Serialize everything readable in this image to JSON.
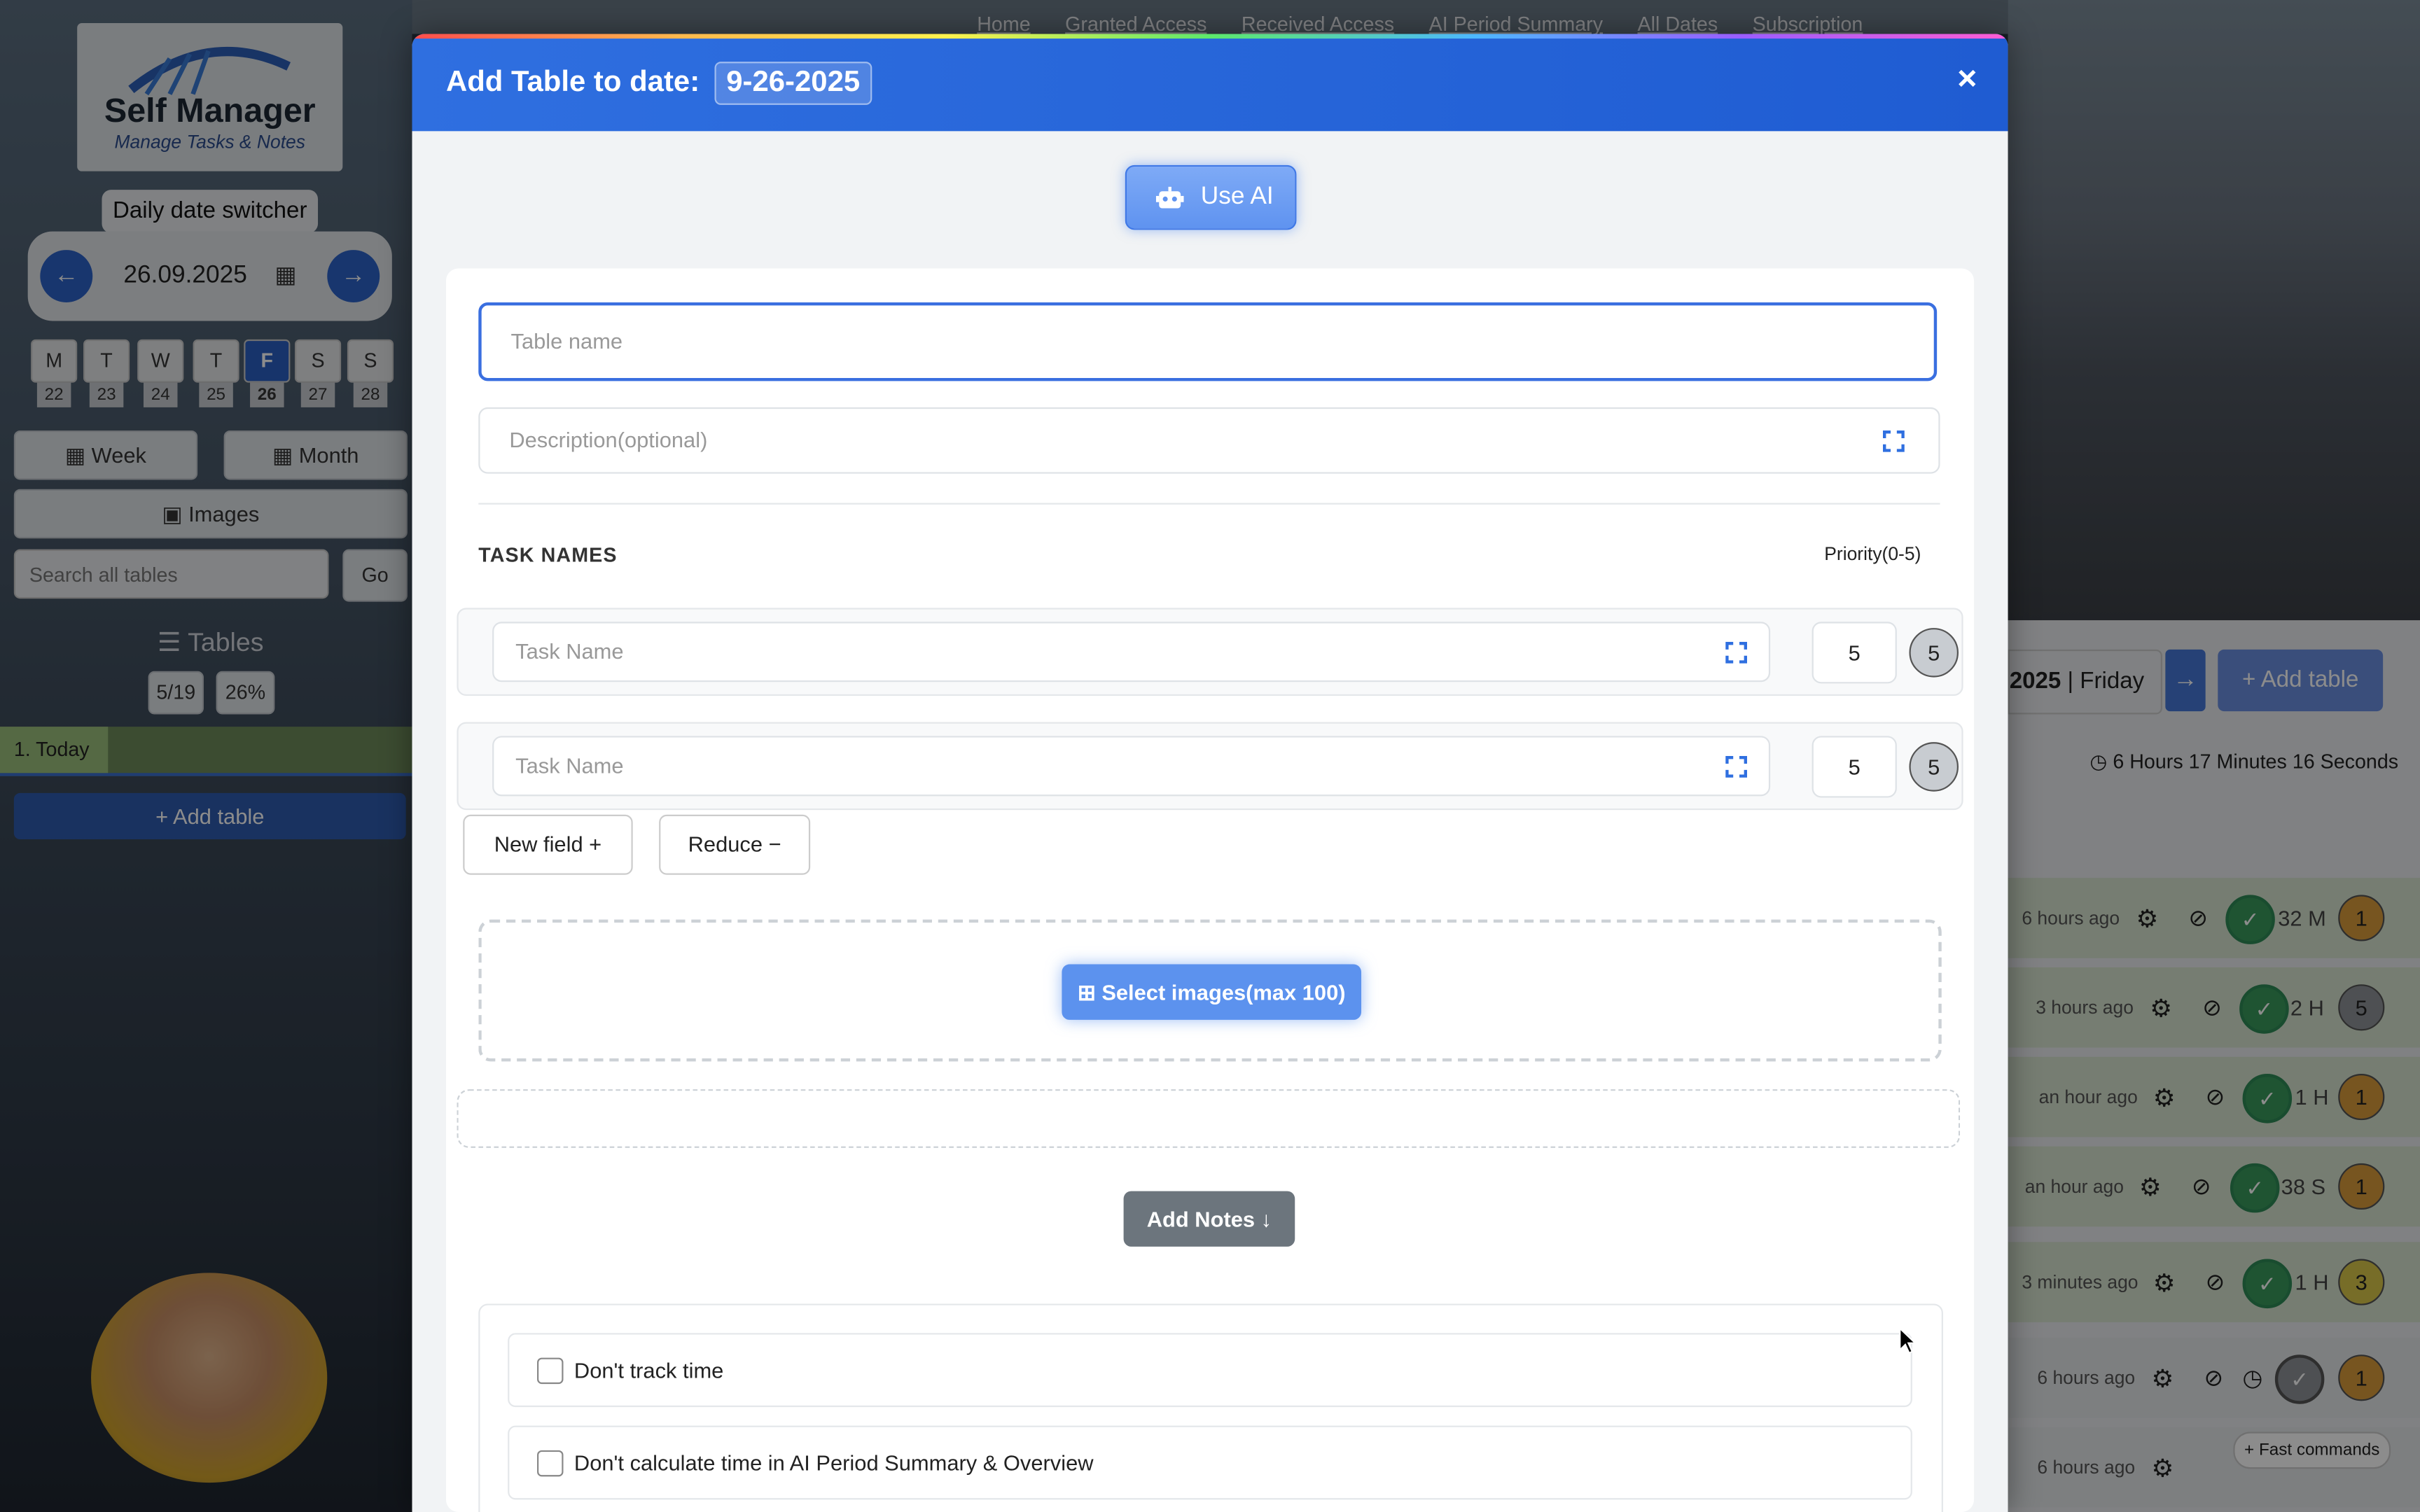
{
  "nav": {
    "items": [
      "Home",
      "Granted Access",
      "Received Access",
      "AI Period Summary",
      "All Dates",
      "Subscription"
    ]
  },
  "sidebar": {
    "logo_title": "Self Manager",
    "logo_subtitle": "Manage Tasks & Notes",
    "date_switcher_label": "Daily date switcher",
    "current_date": "26.09.2025",
    "days": [
      {
        "letter": "M",
        "num": "22"
      },
      {
        "letter": "T",
        "num": "23"
      },
      {
        "letter": "W",
        "num": "24"
      },
      {
        "letter": "T",
        "num": "25"
      },
      {
        "letter": "F",
        "num": "26"
      },
      {
        "letter": "S",
        "num": "27"
      },
      {
        "letter": "S",
        "num": "28"
      }
    ],
    "week_label": "Week",
    "month_label": "Month",
    "images_label": "Images",
    "search_placeholder": "Search all tables",
    "go_label": "Go",
    "tables_label": "Tables",
    "tables_count": "5/19",
    "tables_percent": "26%",
    "today_item": "1. Today",
    "add_table_label": "Add table"
  },
  "right_panel": {
    "date_label": "2025",
    "weekday": "Friday",
    "add_table_label": "Add table",
    "timer": "6 Hours 17 Minutes 16 Seconds",
    "fast_commands": "Fast commands",
    "rows": [
      {
        "ago": "6 hours ago",
        "duration": "32 M",
        "priority": "1"
      },
      {
        "ago": "3 hours ago",
        "duration": "2 H",
        "priority": "5"
      },
      {
        "ago": "an hour ago",
        "duration": "1 H",
        "priority": "1"
      },
      {
        "ago": "an hour ago",
        "duration": "38 S",
        "priority": "1"
      },
      {
        "ago": "3 minutes ago",
        "duration": "1 H",
        "priority": "3"
      },
      {
        "ago": "6 hours ago",
        "duration": "",
        "priority": "1"
      },
      {
        "ago": "6 hours ago",
        "duration": "",
        "priority": ""
      }
    ]
  },
  "modal": {
    "title": "Add Table to date:",
    "date": "9-26-2025",
    "close": "×",
    "use_ai": "Use AI",
    "table_name_placeholder": "Table name",
    "description_placeholder": "Description(optional)",
    "task_names_label": "TASK NAMES",
    "priority_label": "Priority(0-5)",
    "tasks": [
      {
        "placeholder": "Task Name",
        "priority": "5",
        "badge": "5"
      },
      {
        "placeholder": "Task Name",
        "priority": "5",
        "badge": "5"
      }
    ],
    "new_field": "New field +",
    "reduce": "Reduce −",
    "select_images": "Select images(max 100)",
    "add_notes": "Add Notes ↓",
    "options": [
      "Don't track time",
      "Don't calculate time in AI Period Summary & Overview"
    ]
  },
  "colors": {
    "header_blue": "#2f6fe0",
    "accent_blue": "#3a6fe0",
    "notes_gray": "#6c757d"
  }
}
